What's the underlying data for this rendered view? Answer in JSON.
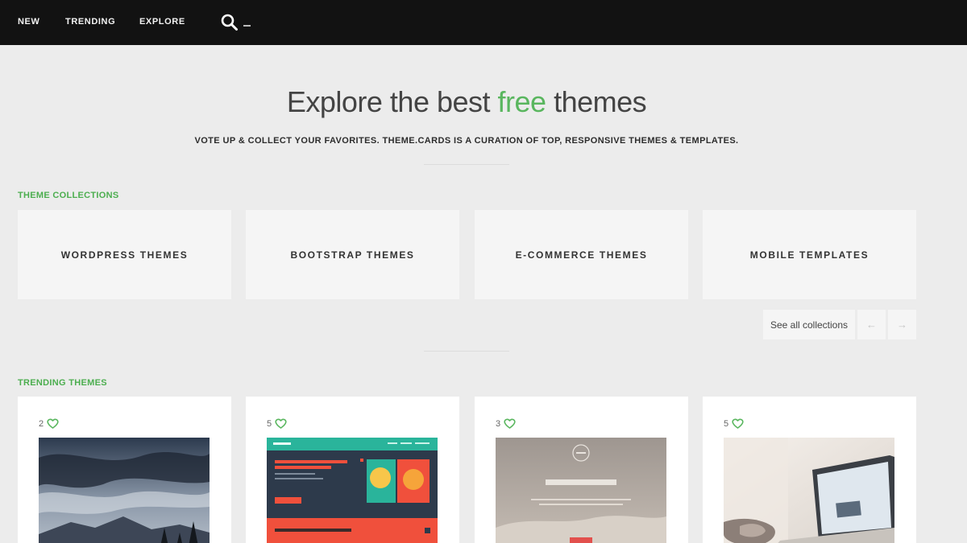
{
  "nav": {
    "links": [
      "NEW",
      "TRENDING",
      "EXPLORE"
    ],
    "search_cursor": "_"
  },
  "hero": {
    "title_before": "Explore the best ",
    "title_accent": "free",
    "title_after": " themes",
    "subtitle": "VOTE UP & COLLECT YOUR FAVORITES. THEME.CARDS IS A CURATION OF TOP, RESPONSIVE THEMES & TEMPLATES."
  },
  "collections": {
    "heading": "THEME COLLECTIONS",
    "items": [
      "WORDPRESS THEMES",
      "BOOTSTRAP THEMES",
      "E-COMMERCE THEMES",
      "MOBILE TEMPLATES"
    ],
    "see_all": "See all collections",
    "prev_symbol": "←",
    "next_symbol": "→"
  },
  "trending": {
    "heading": "TRENDING THEMES",
    "items": [
      {
        "likes": "2"
      },
      {
        "likes": "5"
      },
      {
        "likes": "3"
      },
      {
        "likes": "5"
      }
    ]
  },
  "colors": {
    "accent": "#59b65e",
    "nav_bg": "#121212",
    "page_bg": "#ececec",
    "card_bg": "#f5f5f5"
  },
  "icons": {
    "search": "search-icon",
    "like": "heart-icon",
    "prev": "arrow-left-icon",
    "next": "arrow-right-icon"
  }
}
